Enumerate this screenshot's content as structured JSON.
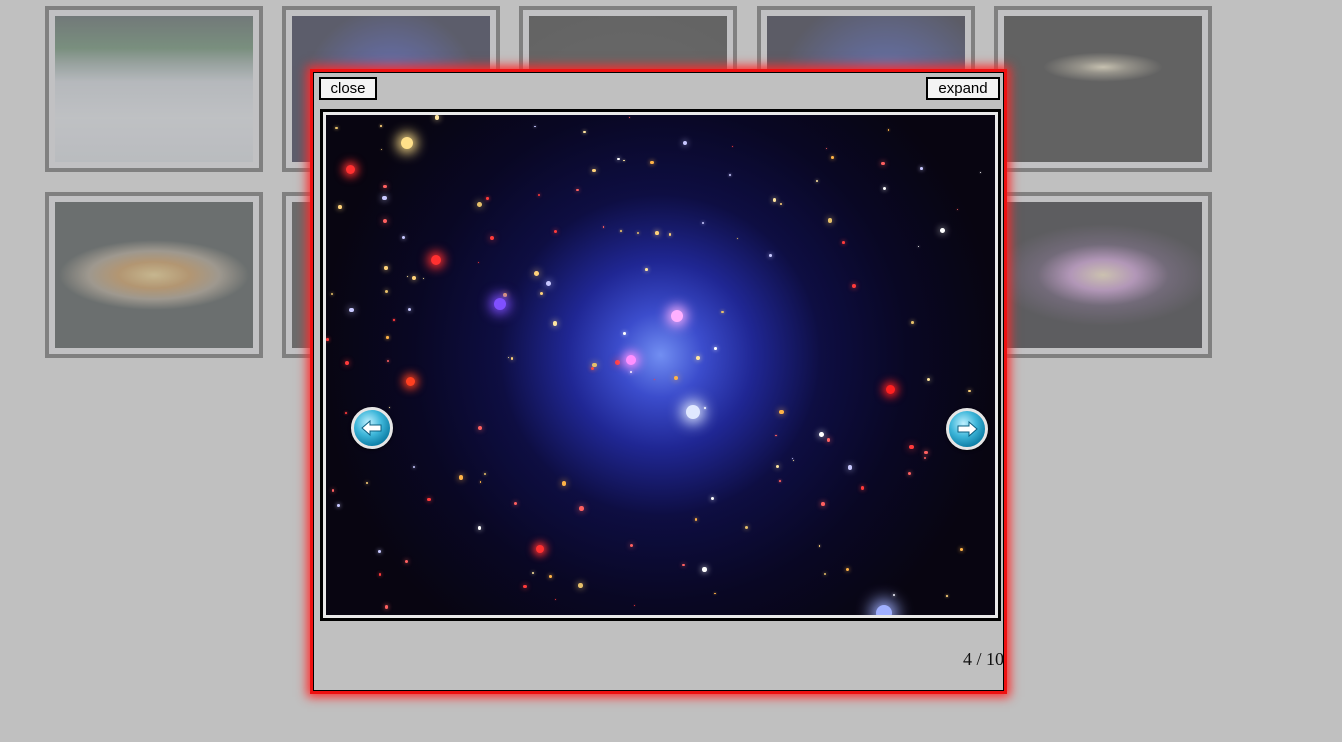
{
  "thumbnails": [
    {
      "name": "aurora-earth"
    },
    {
      "name": "galaxy-cluster-a"
    },
    {
      "name": "earth-globe"
    },
    {
      "name": "galaxy-cluster-b"
    },
    {
      "name": "edge-on-galaxy"
    },
    {
      "name": "protoplanetary-disk"
    },
    {
      "name": "hidden-thumb"
    },
    {
      "name": "spiral-galaxy"
    }
  ],
  "lightbox": {
    "close_label": "close",
    "expand_label": "expand",
    "counter": "4 / 10",
    "current_index": 4,
    "total": 10
  },
  "icons": {
    "prev": "arrow-left-icon",
    "next": "arrow-right-icon"
  },
  "colors": {
    "overlay_border": "#ee1111",
    "page_background": "#c0c0c0"
  }
}
